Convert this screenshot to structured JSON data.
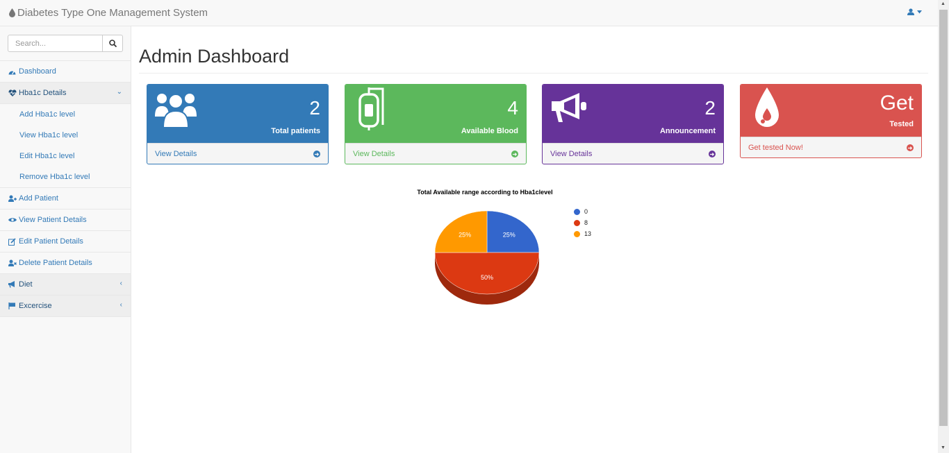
{
  "app": {
    "title": "Diabetes Type One Management System"
  },
  "search": {
    "placeholder": "Search..."
  },
  "sidebar": {
    "dashboard": "Dashboard",
    "hba1c": {
      "label": "Hba1c Details",
      "items": [
        "Add Hba1c level",
        "View Hba1c level",
        "Edit Hba1c level",
        "Remove Hba1c level"
      ]
    },
    "add_patient": "Add Patient",
    "view_patient": "View Patient Details",
    "edit_patient": "Edit Patient Details",
    "delete_patient": "Delete Patient Details",
    "diet": "Diet",
    "exercise": "Excercise"
  },
  "page": {
    "title": "Admin Dashboard"
  },
  "panels": {
    "patients": {
      "count": "2",
      "label": "Total patients",
      "footer": "View Details",
      "color": "#337ab7"
    },
    "blood": {
      "count": "4",
      "label": "Available Blood",
      "footer": "View Details",
      "color": "#5cb85c"
    },
    "announcement": {
      "count": "2",
      "label": "Announcement",
      "footer": "View Details",
      "color": "#663399"
    },
    "tested": {
      "count": "Get",
      "label": "Tested",
      "footer": "Get tested Now!",
      "color": "#d9534f"
    }
  },
  "chart_data": {
    "type": "pie",
    "title": "Total Available range according to Hba1clevel",
    "slices": [
      {
        "label": "0",
        "value": 25,
        "color": "#3366cc",
        "text": "25%"
      },
      {
        "label": "8",
        "value": 50,
        "color": "#dc3912",
        "text": "50%"
      },
      {
        "label": "13",
        "value": 25,
        "color": "#ff9900",
        "text": "25%"
      }
    ],
    "legend_position": "right",
    "style": "3d"
  }
}
